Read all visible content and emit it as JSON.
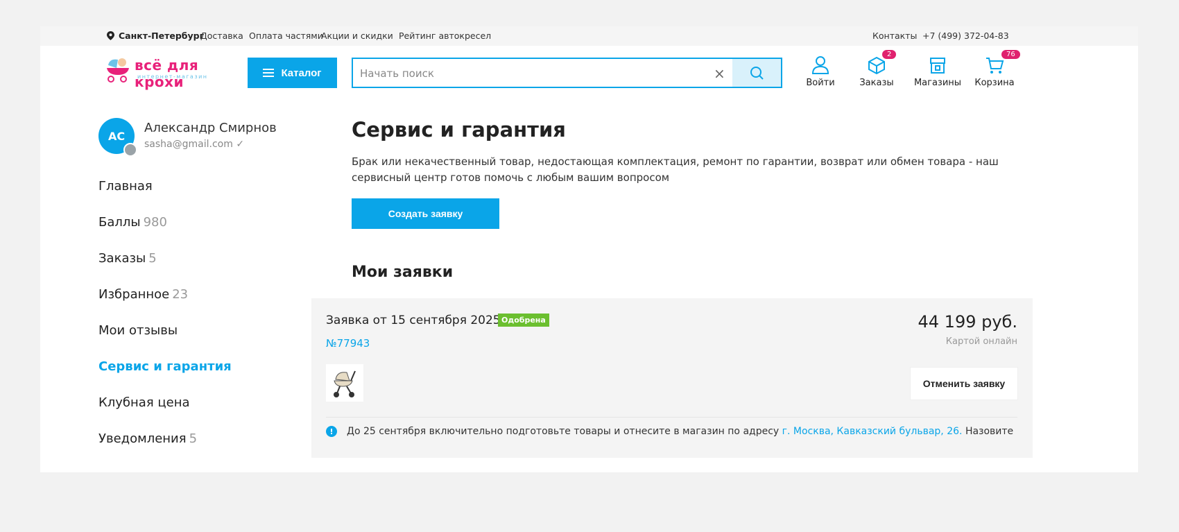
{
  "topbar": {
    "city": "Санкт-Петербург",
    "links": [
      "Доставка",
      "Оплата частями",
      "Акции и скидки",
      "Рейтинг автокресел"
    ],
    "contacts": "Контакты",
    "phone": "+7 (499) 372-04-83"
  },
  "header": {
    "logo_brand": "всё для крохи",
    "logo_tag": "интернет-магазин",
    "catalog_label": "Каталог",
    "search_placeholder": "Начать поиск",
    "icons": {
      "login": "Войти",
      "orders": "Заказы",
      "orders_badge": "2",
      "stores": "Магазины",
      "cart": "Корзина",
      "cart_badge": "76"
    }
  },
  "user": {
    "initials": "АС",
    "name": "Александр Смирнов",
    "email": "sasha@gmail.com"
  },
  "menu": [
    {
      "label": "Главная",
      "count": ""
    },
    {
      "label": "Баллы",
      "count": "980"
    },
    {
      "label": "Заказы",
      "count": "5"
    },
    {
      "label": "Избранное",
      "count": "23"
    },
    {
      "label": "Мои отзывы",
      "count": ""
    },
    {
      "label": "Сервис и гарантия",
      "count": "",
      "active": true
    },
    {
      "label": "Клубная цена",
      "count": ""
    },
    {
      "label": "Уведомления",
      "count": "5"
    }
  ],
  "main": {
    "title": "Сервис и гарантия",
    "description": "Брак или некачественный товар, недостающая комплектация, ремонт по гарантии, возврат или обмен товара - наш сервисный центр готов помочь с любым вашим вопросом",
    "create_label": "Создать заявку",
    "subtitle": "Мои заявки"
  },
  "request": {
    "title": "Заявка от 15 сентября 2025",
    "status": "Одобрена",
    "number": "№77943",
    "price": "44 199 руб.",
    "payment": "Картой онлайн",
    "cancel_label": "Отменить заявку",
    "info_text": "До 25 сентября включительно подготовьте товары и отнесите в магазин по адресу",
    "info_address": "г. Москва, Кавказский бульвар, 26.",
    "info_tail": "Назовите"
  },
  "colors": {
    "accent": "#0aa5e8",
    "brand_pink": "#e8217a",
    "badge": "#e0216e",
    "status_green": "#6bbf2f"
  }
}
